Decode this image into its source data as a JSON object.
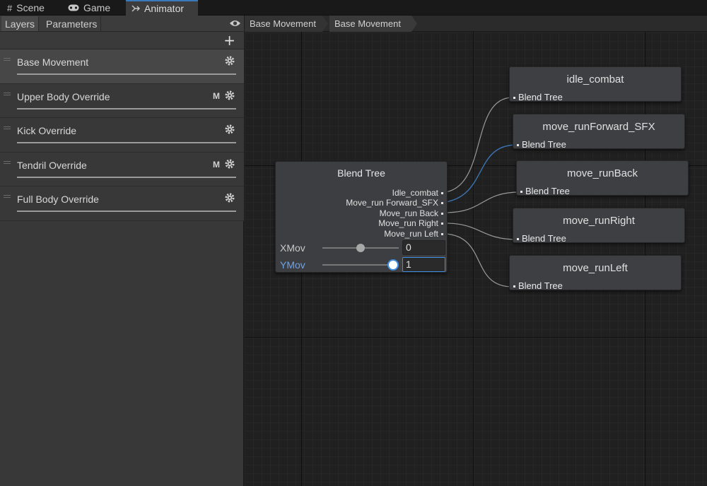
{
  "tabs": [
    {
      "label": "Scene",
      "icon": "grid-icon"
    },
    {
      "label": "Game",
      "icon": "gamepad-icon"
    },
    {
      "label": "Animator",
      "icon": "animator-icon"
    }
  ],
  "left_panel": {
    "tabs": [
      "Layers",
      "Parameters"
    ],
    "layers": [
      {
        "name": "Base Movement",
        "badge": "",
        "selected": true
      },
      {
        "name": "Upper Body Override",
        "badge": "M"
      },
      {
        "name": "Kick Override",
        "badge": ""
      },
      {
        "name": "Tendril Override",
        "badge": "M"
      },
      {
        "name": "Full Body Override",
        "badge": ""
      }
    ]
  },
  "breadcrumbs": [
    "Base Movement",
    "Base Movement"
  ],
  "blend_tree": {
    "title": "Blend Tree",
    "outputs": [
      "Idle_combat",
      "Move_run Forward_SFX",
      "Move_run Back",
      "Move_run Right",
      "Move_run Left"
    ],
    "params": [
      {
        "name": "XMov",
        "value": "0"
      },
      {
        "name": "YMov",
        "value": "1"
      }
    ]
  },
  "clips": [
    {
      "title": "idle_combat",
      "input": "Blend Tree"
    },
    {
      "title": "move_runForward_SFX",
      "input": "Blend Tree"
    },
    {
      "title": "move_runBack",
      "input": "Blend Tree"
    },
    {
      "title": "move_runRight",
      "input": "Blend Tree"
    },
    {
      "title": "move_runLeft",
      "input": "Blend Tree"
    }
  ],
  "colors": {
    "accent": "#3d8de3",
    "selected_wire": "#3b73b0"
  }
}
